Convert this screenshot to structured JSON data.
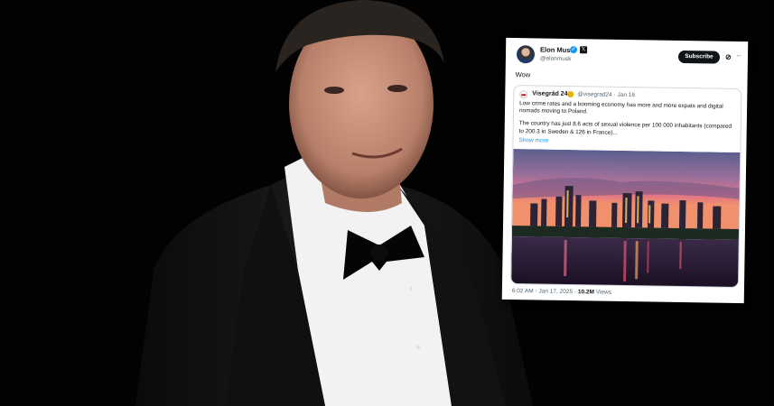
{
  "tweet": {
    "author_name": "Elon Musk",
    "author_handle": "@elonmusk",
    "subscribe_label": "Subscribe",
    "grok_icon": "grok-icon",
    "more_icon": "more-icon",
    "text": "Wow",
    "quoted": {
      "author_name": "Visegrád 24",
      "author_handle_date": "@visegrad24 · Jan 16",
      "paragraph_1": "Low crime rates and a booming economy has more and more expats and digital nomads moving to Poland.",
      "paragraph_2": "The country has just 8.6 acts of sexual violence per 100 000 inhabitants (compared to 200.3 in Sweden & 126 in France)...",
      "show_more": "Show more"
    },
    "time_date": "6:02 AM · Jan 17, 2025 ·",
    "views_count": "10.2M",
    "views_label": "Views"
  },
  "colors": {
    "verified_blue": "#1d9bf0",
    "background": "#000000"
  }
}
